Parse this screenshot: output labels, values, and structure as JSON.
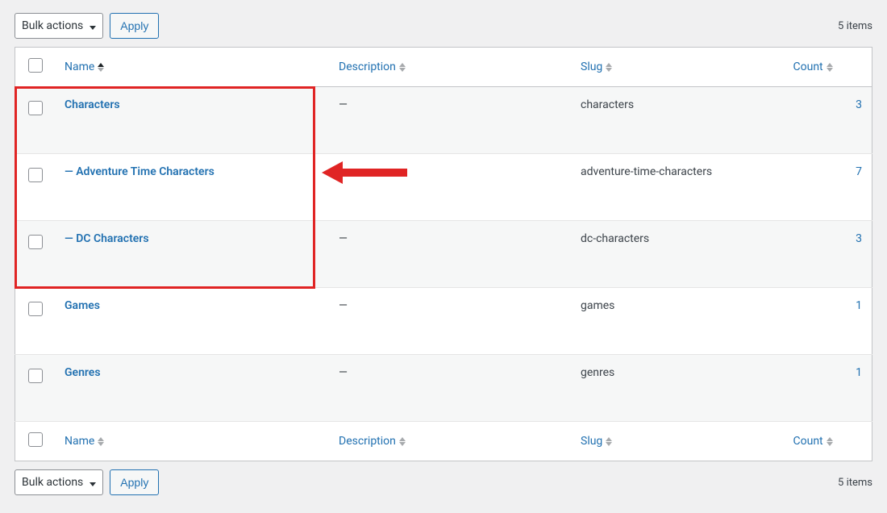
{
  "toolbar": {
    "bulk_label": "Bulk actions",
    "apply_label": "Apply",
    "items_count_text": "5 items"
  },
  "columns": {
    "name": "Name",
    "description": "Description",
    "slug": "Slug",
    "count": "Count"
  },
  "rows": [
    {
      "name": "Characters",
      "indent": "",
      "description": "—",
      "slug": "characters",
      "count": "3"
    },
    {
      "name": "Adventure Time Characters",
      "indent": "— ",
      "description": "",
      "slug": "adventure-time-characters",
      "count": "7"
    },
    {
      "name": "DC Characters",
      "indent": "— ",
      "description": "—",
      "slug": "dc-characters",
      "count": "3"
    },
    {
      "name": "Games",
      "indent": "",
      "description": "—",
      "slug": "games",
      "count": "1"
    },
    {
      "name": "Genres",
      "indent": "",
      "description": "—",
      "slug": "genres",
      "count": "1"
    }
  ],
  "annotation": {
    "type": "highlight-with-arrow",
    "color": "#e02424"
  }
}
